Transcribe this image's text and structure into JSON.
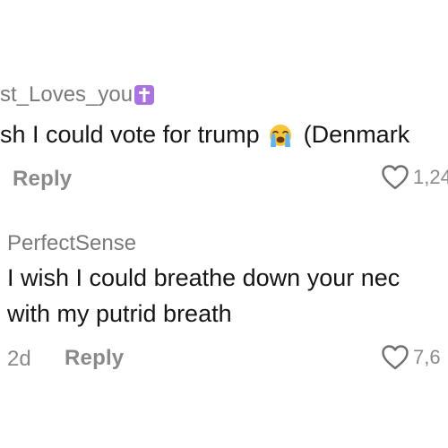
{
  "comments": [
    {
      "username": "st_Loves_you",
      "badge_icon": "latin-cross-icon",
      "text_before_emoji": "sh I could vote for trump",
      "emoji_icon": "loudly-crying-face-icon",
      "text_after_emoji": "(Denmark",
      "reply_label": "Reply",
      "like_count": "1,24"
    },
    {
      "username": "PerfectSense",
      "text_line_1": "I wish I could breathe down your nec",
      "text_line_2": "with my putrid breath",
      "age": "2d",
      "reply_label": "Reply",
      "like_count": "7,6"
    }
  ],
  "colors": {
    "background": "#ffffff",
    "text_primary": "#161616",
    "text_secondary": "#8a8a8a",
    "badge_purple": "#a973e0"
  }
}
